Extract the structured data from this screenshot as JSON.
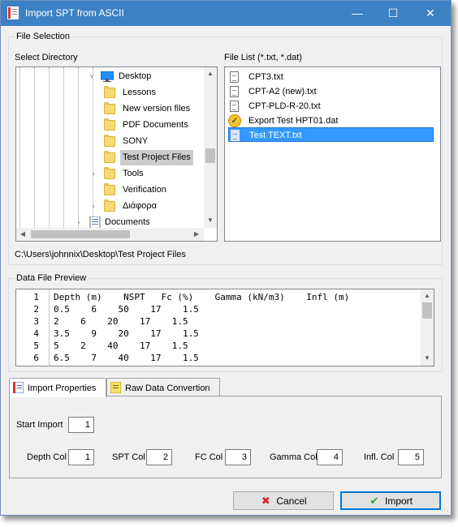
{
  "window": {
    "title": "Import SPT from ASCII",
    "controls": {
      "minimize": "—",
      "maximize": "☐",
      "close": "✕"
    }
  },
  "file_selection": {
    "group_title": "File Selection",
    "directory_label": "Select Directory",
    "file_list_label": "File List (*.txt, *.dat)",
    "tree": [
      {
        "label": "Desktop",
        "icon": "desktop-icon",
        "expander": "˅",
        "selected": false
      },
      {
        "label": "Lessons",
        "icon": "folder-icon",
        "expander": "",
        "selected": false
      },
      {
        "label": "New version files",
        "icon": "folder-icon",
        "expander": "",
        "selected": false
      },
      {
        "label": "PDF Documents",
        "icon": "folder-icon",
        "expander": "",
        "selected": false
      },
      {
        "label": "SONY",
        "icon": "folder-icon",
        "expander": "",
        "selected": false
      },
      {
        "label": "Test Project Files",
        "icon": "folder-icon",
        "expander": "",
        "selected": true
      },
      {
        "label": "Tools",
        "icon": "folder-icon",
        "expander": "›",
        "selected": false
      },
      {
        "label": "Verification",
        "icon": "folder-icon",
        "expander": "",
        "selected": false
      },
      {
        "label": "Διάφορα",
        "icon": "folder-icon",
        "expander": "›",
        "selected": false
      },
      {
        "label": "Documents",
        "icon": "documents-icon",
        "expander": "›",
        "selected": false
      }
    ],
    "files": [
      {
        "name": "CPT3.txt",
        "icon": "document-icon",
        "selected": false
      },
      {
        "name": "CPT-A2 (new).txt",
        "icon": "document-icon",
        "selected": false
      },
      {
        "name": "CPT-PLD-R-20.txt",
        "icon": "document-icon",
        "selected": false
      },
      {
        "name": "Export Test HPT01.dat",
        "icon": "checkmark-icon",
        "selected": false
      },
      {
        "name": "Test TEXT.txt",
        "icon": "document-icon",
        "selected": true
      }
    ],
    "current_path": "C:\\Users\\johnnix\\Desktop\\Test Project Files"
  },
  "preview": {
    "group_title": "Data File Preview",
    "rows": [
      {
        "num": "1",
        "text": "Depth (m)    NSPT   Fc (%)    Gamma (kN/m3)    Infl (m)"
      },
      {
        "num": "2",
        "text": "0.5    6    50    17    1.5"
      },
      {
        "num": "3",
        "text": "2    6    20    17    1.5"
      },
      {
        "num": "4",
        "text": "3.5    9    20    17    1.5"
      },
      {
        "num": "5",
        "text": "5    2    40    17    1.5"
      },
      {
        "num": "6",
        "text": "6.5    7    40    17    1.5"
      }
    ]
  },
  "tabs": [
    {
      "label": "Import Properties",
      "icon": "properties-icon",
      "active": true
    },
    {
      "label": "Raw Data Convertion",
      "icon": "raw-data-icon",
      "active": false
    }
  ],
  "import_properties": {
    "start_import_label": "Start Import",
    "start_import": "1",
    "depth_col_label": "Depth Col",
    "depth_col": "1",
    "spt_col_label": "SPT Col",
    "spt_col": "2",
    "fc_col_label": "FC Col",
    "fc_col": "3",
    "gamma_col_label": "Gamma Col",
    "gamma_col": "4",
    "infl_col_label": "Infl. Col",
    "infl_col": "5"
  },
  "buttons": {
    "cancel": "Cancel",
    "import": "Import"
  },
  "colors": {
    "titlebar": "#3c81c4",
    "selection": "#3399ff",
    "cancel_icon": "#d9262c",
    "import_icon": "#2e9e3a"
  }
}
